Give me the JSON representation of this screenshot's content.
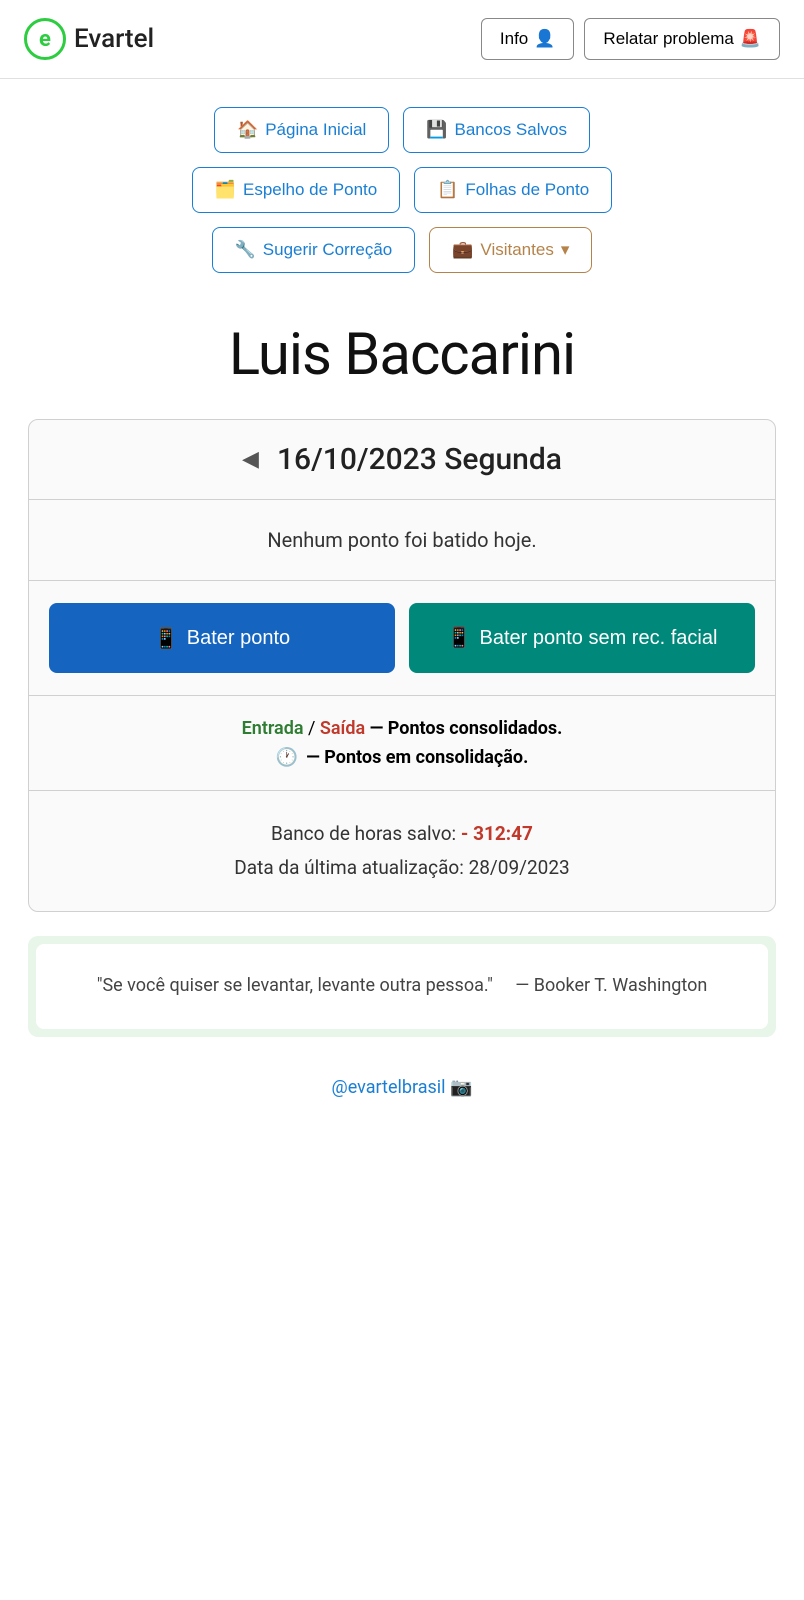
{
  "header": {
    "logo_letter": "e",
    "logo_name": "Evartel",
    "btn_info_label": "Info",
    "btn_info_icon": "👤",
    "btn_report_label": "Relatar problema",
    "btn_report_icon": "🚨"
  },
  "nav": {
    "btn_home_icon": "🏠",
    "btn_home_label": "Página Inicial",
    "btn_banks_icon": "💾",
    "btn_banks_label": "Bancos Salvos",
    "btn_mirror_icon": "🗂️",
    "btn_mirror_label": "Espelho de Ponto",
    "btn_sheets_icon": "📋",
    "btn_sheets_label": "Folhas de Ponto",
    "btn_suggest_icon": "🔧",
    "btn_suggest_label": "Sugerir Correção",
    "btn_visitors_icon": "💼",
    "btn_visitors_label": "Visitantes",
    "btn_visitors_arrow": "▾"
  },
  "user": {
    "name": "Luis Baccarini"
  },
  "date_card": {
    "arrow": "◀",
    "date": "16/10/2023 Segunda",
    "no_punch_msg": "Nenhum ponto foi batido hoje.",
    "btn_punch_icon": "📱",
    "btn_punch_label": "Bater ponto",
    "btn_punch_no_face_icon": "📱",
    "btn_punch_no_face_label": "Bater ponto sem rec. facial",
    "legend_entrada": "Entrada",
    "legend_slash": " / ",
    "legend_saida": "Saída",
    "legend_consolidated": "— Pontos consolidados.",
    "legend_clock_icon": "🕐",
    "legend_consolidating": "— Pontos em consolidação.",
    "bank_label": "Banco de horas salvo:",
    "bank_value": "- 312:47",
    "update_label": "Data da última atualização:",
    "update_value": "28/09/2023"
  },
  "quote": {
    "text": "\"Se você quiser se levantar, levante outra pessoa.\"",
    "author": "— Booker T. Washington"
  },
  "footer": {
    "instagram_label": "@evartelbrasil",
    "instagram_icon": "📷"
  }
}
